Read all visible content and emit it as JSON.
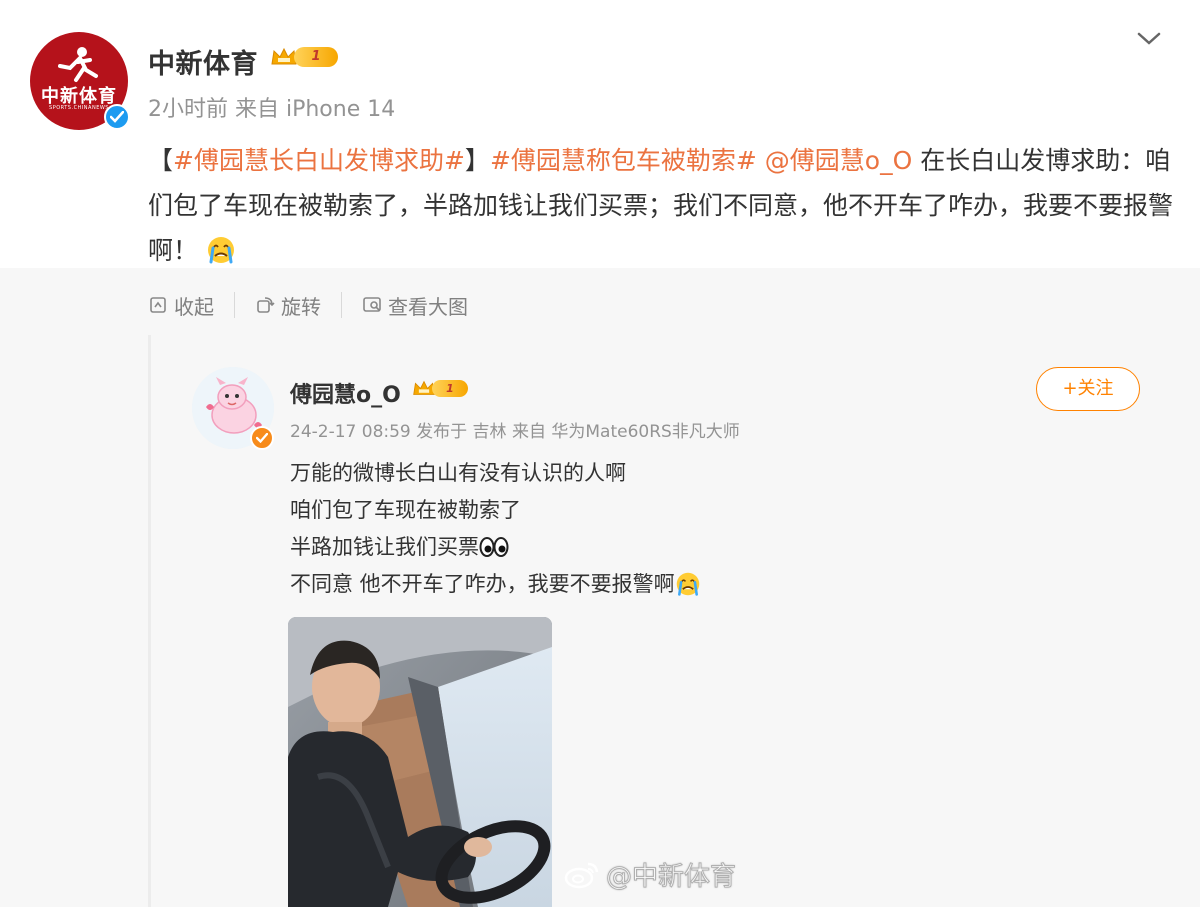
{
  "author": {
    "name": "中新体育",
    "vip_level": "1",
    "meta": "2小时前  来自 iPhone 14",
    "logo_text": "中新体育",
    "logo_sub": "SPORTS.CHINANEWS"
  },
  "post": {
    "text_parts": {
      "bracket_open": "【",
      "tag1": "#傅园慧长白山发博求助#",
      "bracket_close": "】",
      "tag2": "#傅园慧称包车被勒索#",
      "mention": "@傅园慧o_O",
      "body": " 在长白山发博求助：咱们包了车现在被勒索了，半路加钱让我们买票；我们不同意，他不开车了咋办，我要不要报警啊！"
    }
  },
  "actions": [
    {
      "label": "收起",
      "icon": "collapse-icon"
    },
    {
      "label": "旋转",
      "icon": "rotate-icon"
    },
    {
      "label": "查看大图",
      "icon": "view-image-icon"
    }
  ],
  "repost": {
    "name": "傅园慧o_O",
    "vip_level": "1",
    "meta": "24-2-17 08:59 发布于 吉林  来自 华为Mate60RS非凡大师",
    "follow_label": "+关注",
    "lines": [
      "万能的微博长白山有没有认识的人啊",
      "咱们包了车现在被勒索了",
      "半路加钱让我们买票",
      "不同意 他不开车了咋办，我要不要报警啊"
    ],
    "watermark": "@中新体育"
  },
  "colors": {
    "tag": "#eb7340",
    "follow": "#ff8200",
    "verified_blue": "#1d9bf0",
    "verified_orange": "#f78b1b",
    "brand_red": "#b5121b"
  }
}
